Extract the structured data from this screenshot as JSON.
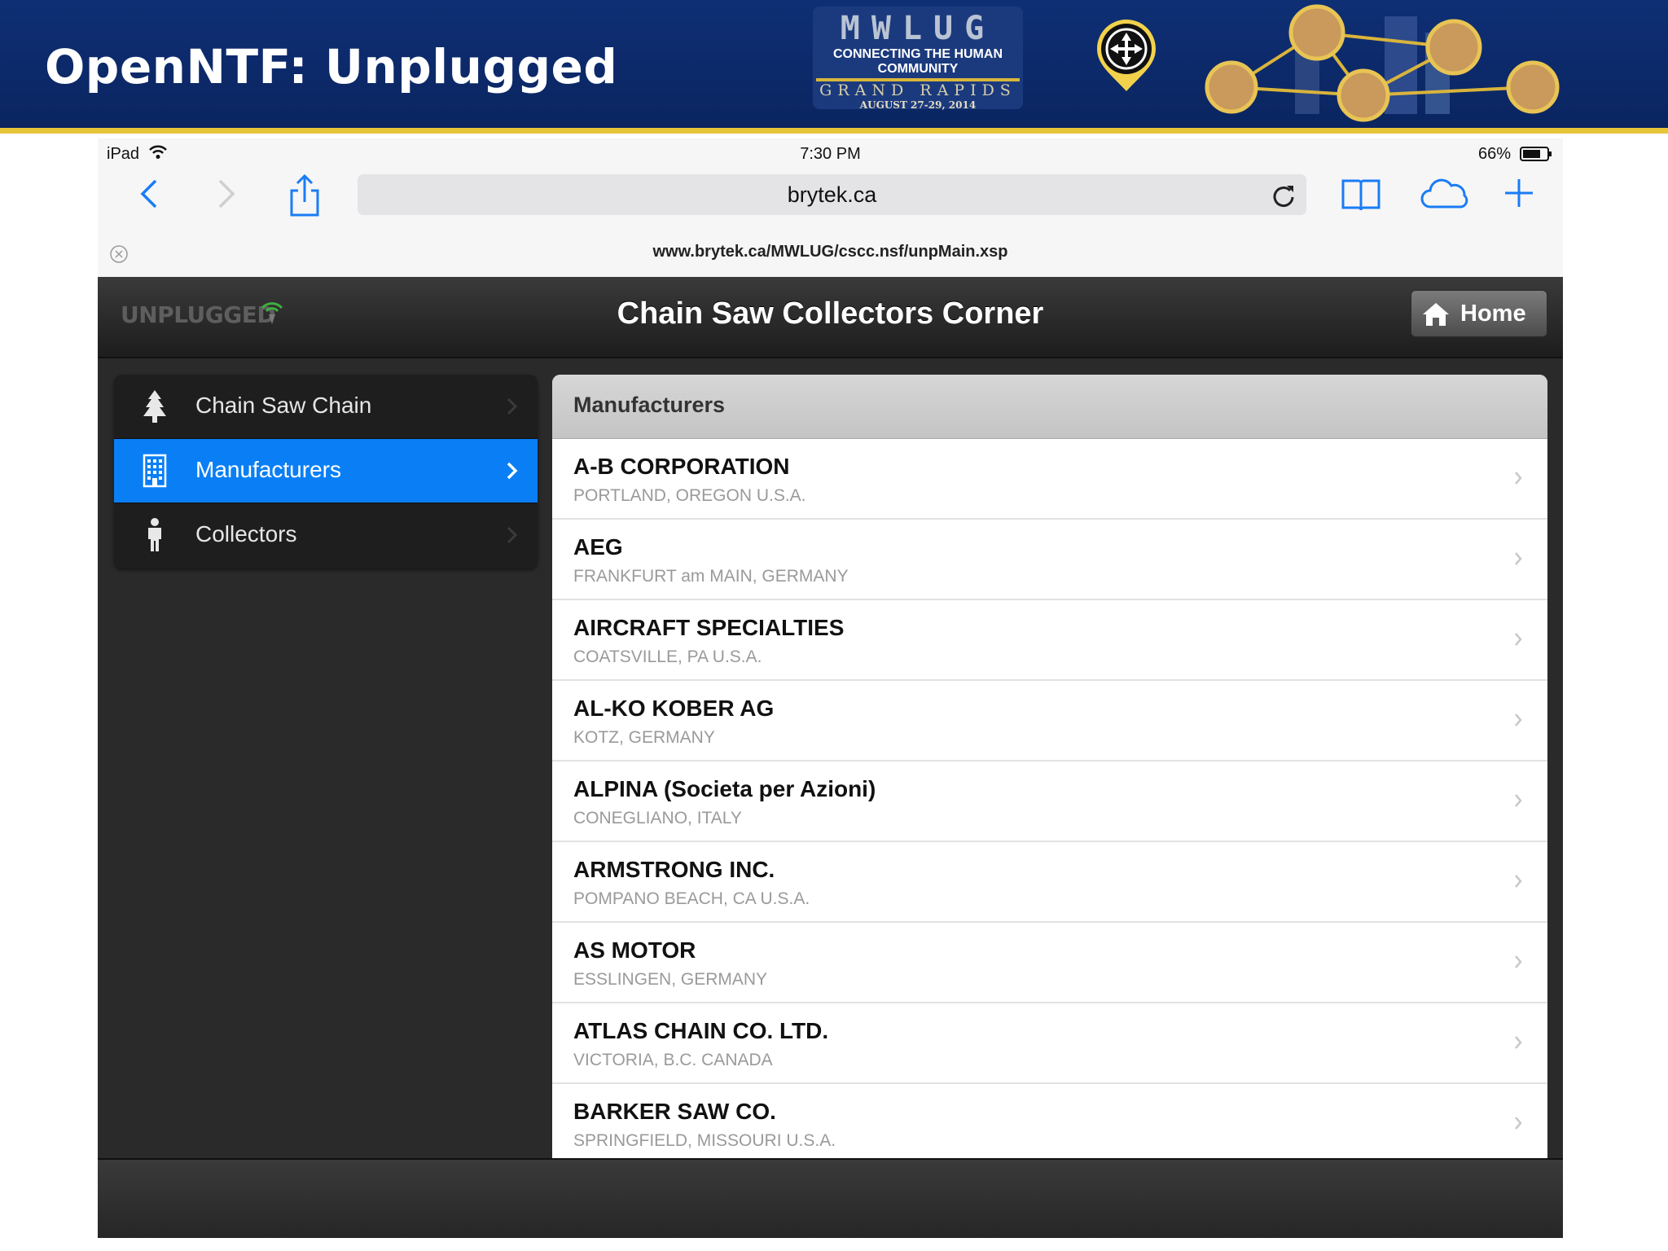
{
  "slide": {
    "title": "OpenNTF: Unplugged",
    "logo": {
      "letters": "MWLUG",
      "tagline": "CONNECTING THE HUMAN COMMUNITY",
      "city": "GRAND RAPIDS",
      "date": "AUGUST 27-29, 2014"
    },
    "colors": {
      "banner": "#0f2f75",
      "stripe": "#e7c53a"
    }
  },
  "ipad": {
    "status": {
      "device": "iPad",
      "time": "7:30 PM",
      "battery": "66%"
    },
    "toolbar": {
      "address": "brytek.ca",
      "icons": [
        "back-icon",
        "forward-icon",
        "share-icon",
        "reload-icon",
        "bookmarks-icon",
        "cloud-icon",
        "new-tab-icon"
      ]
    },
    "tab": {
      "title": "www.brytek.ca/MWLUG/cscc.nsf/unpMain.xsp"
    }
  },
  "app": {
    "logo_text": "UNPLUGGED",
    "title": "Chain Saw Collectors Corner",
    "home_label": "Home",
    "nav": [
      {
        "label": "Chain Saw Chain",
        "icon": "tree-icon",
        "selected": false
      },
      {
        "label": "Manufacturers",
        "icon": "building-icon",
        "selected": true
      },
      {
        "label": "Collectors",
        "icon": "person-icon",
        "selected": false
      }
    ],
    "list": {
      "header": "Manufacturers",
      "rows": [
        {
          "name": "A-B CORPORATION",
          "location": "PORTLAND, OREGON U.S.A."
        },
        {
          "name": "AEG",
          "location": "FRANKFURT am MAIN, GERMANY"
        },
        {
          "name": "AIRCRAFT SPECIALTIES",
          "location": "COATSVILLE, PA U.S.A."
        },
        {
          "name": "AL-KO KOBER AG",
          "location": "KOTZ, GERMANY"
        },
        {
          "name": "ALPINA (Societa per Azioni)",
          "location": "CONEGLIANO, ITALY"
        },
        {
          "name": "ARMSTRONG INC.",
          "location": "POMPANO BEACH, CA U.S.A."
        },
        {
          "name": "AS MOTOR",
          "location": "ESSLINGEN, GERMANY"
        },
        {
          "name": "ATLAS CHAIN CO. LTD.",
          "location": "VICTORIA, B.C. CANADA"
        },
        {
          "name": "BARKER SAW CO.",
          "location": "SPRINGFIELD, MISSOURI U.S.A."
        }
      ]
    },
    "colors": {
      "selected": "#0a7ff5",
      "header": "#1d1d1d"
    }
  }
}
